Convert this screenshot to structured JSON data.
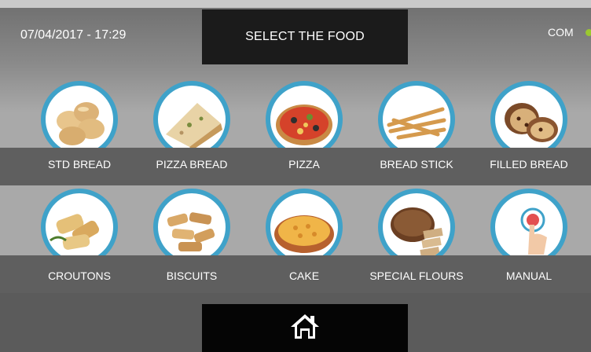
{
  "header": {
    "datetime": "07/04/2017 - 17:29",
    "title": "SELECT THE FOOD",
    "com_label": "COM",
    "com_status_color": "#9bc82f"
  },
  "foods": [
    {
      "label": "STD BREAD",
      "icon": "bread-rolls-icon"
    },
    {
      "label": "PIZZA BREAD",
      "icon": "pizza-bread-icon"
    },
    {
      "label": "PIZZA",
      "icon": "pizza-icon"
    },
    {
      "label": "BREAD STICK",
      "icon": "bread-stick-icon"
    },
    {
      "label": "FILLED BREAD",
      "icon": "filled-bread-icon"
    },
    {
      "label": "CROUTONS",
      "icon": "croutons-icon"
    },
    {
      "label": "BISCUITS",
      "icon": "biscuits-icon"
    },
    {
      "label": "CAKE",
      "icon": "cake-icon"
    },
    {
      "label": "SPECIAL FLOURS",
      "icon": "special-flours-icon"
    },
    {
      "label": "MANUAL",
      "icon": "manual-touch-icon"
    }
  ],
  "footer": {
    "home_icon": "home-icon"
  },
  "colors": {
    "circle_border": "#3fa2c9",
    "band": "#5f5f5f",
    "title_bg": "#1b1b1b"
  }
}
